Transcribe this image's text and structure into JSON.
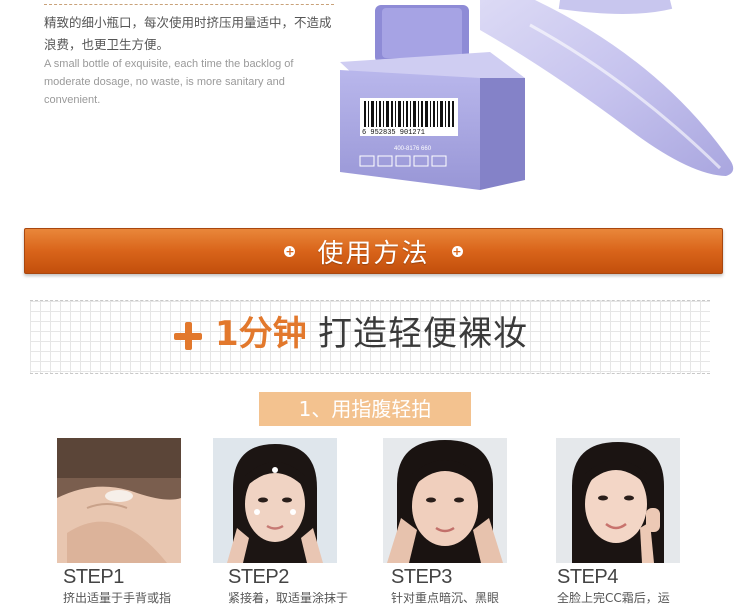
{
  "intro": {
    "cn_text": "精致的细小瓶口，每次使用时挤压用量适中，不造成浪费，也更卫生方便。",
    "en_text": "A small bottle of exquisite, each time the backlog of moderate dosage, no waste, is more sanitary and convenient."
  },
  "product": {
    "barcode_number": "6 952835 901271",
    "hotline": "400-8176 660"
  },
  "banner": {
    "plus_left": "+",
    "title": "使用方法",
    "plus_right": "+"
  },
  "heading": {
    "plus": "+",
    "time": "1分钟",
    "rest": "打造轻便裸妆"
  },
  "step_label": "1、用指腹轻拍",
  "steps": [
    {
      "title": "STEP1",
      "desc": "挤出适量于手背或指"
    },
    {
      "title": "STEP2",
      "desc": "紧接着，取适量涂抹于"
    },
    {
      "title": "STEP3",
      "desc": "针对重点暗沉、黑眼"
    },
    {
      "title": "STEP4",
      "desc": "全脸上完CC霜后，运"
    }
  ],
  "colors": {
    "banner_orange": "#d9641a",
    "accent_orange": "#e2782c",
    "step_label_bg": "#f3c28f",
    "product_lavender": "#a8a6e0"
  }
}
